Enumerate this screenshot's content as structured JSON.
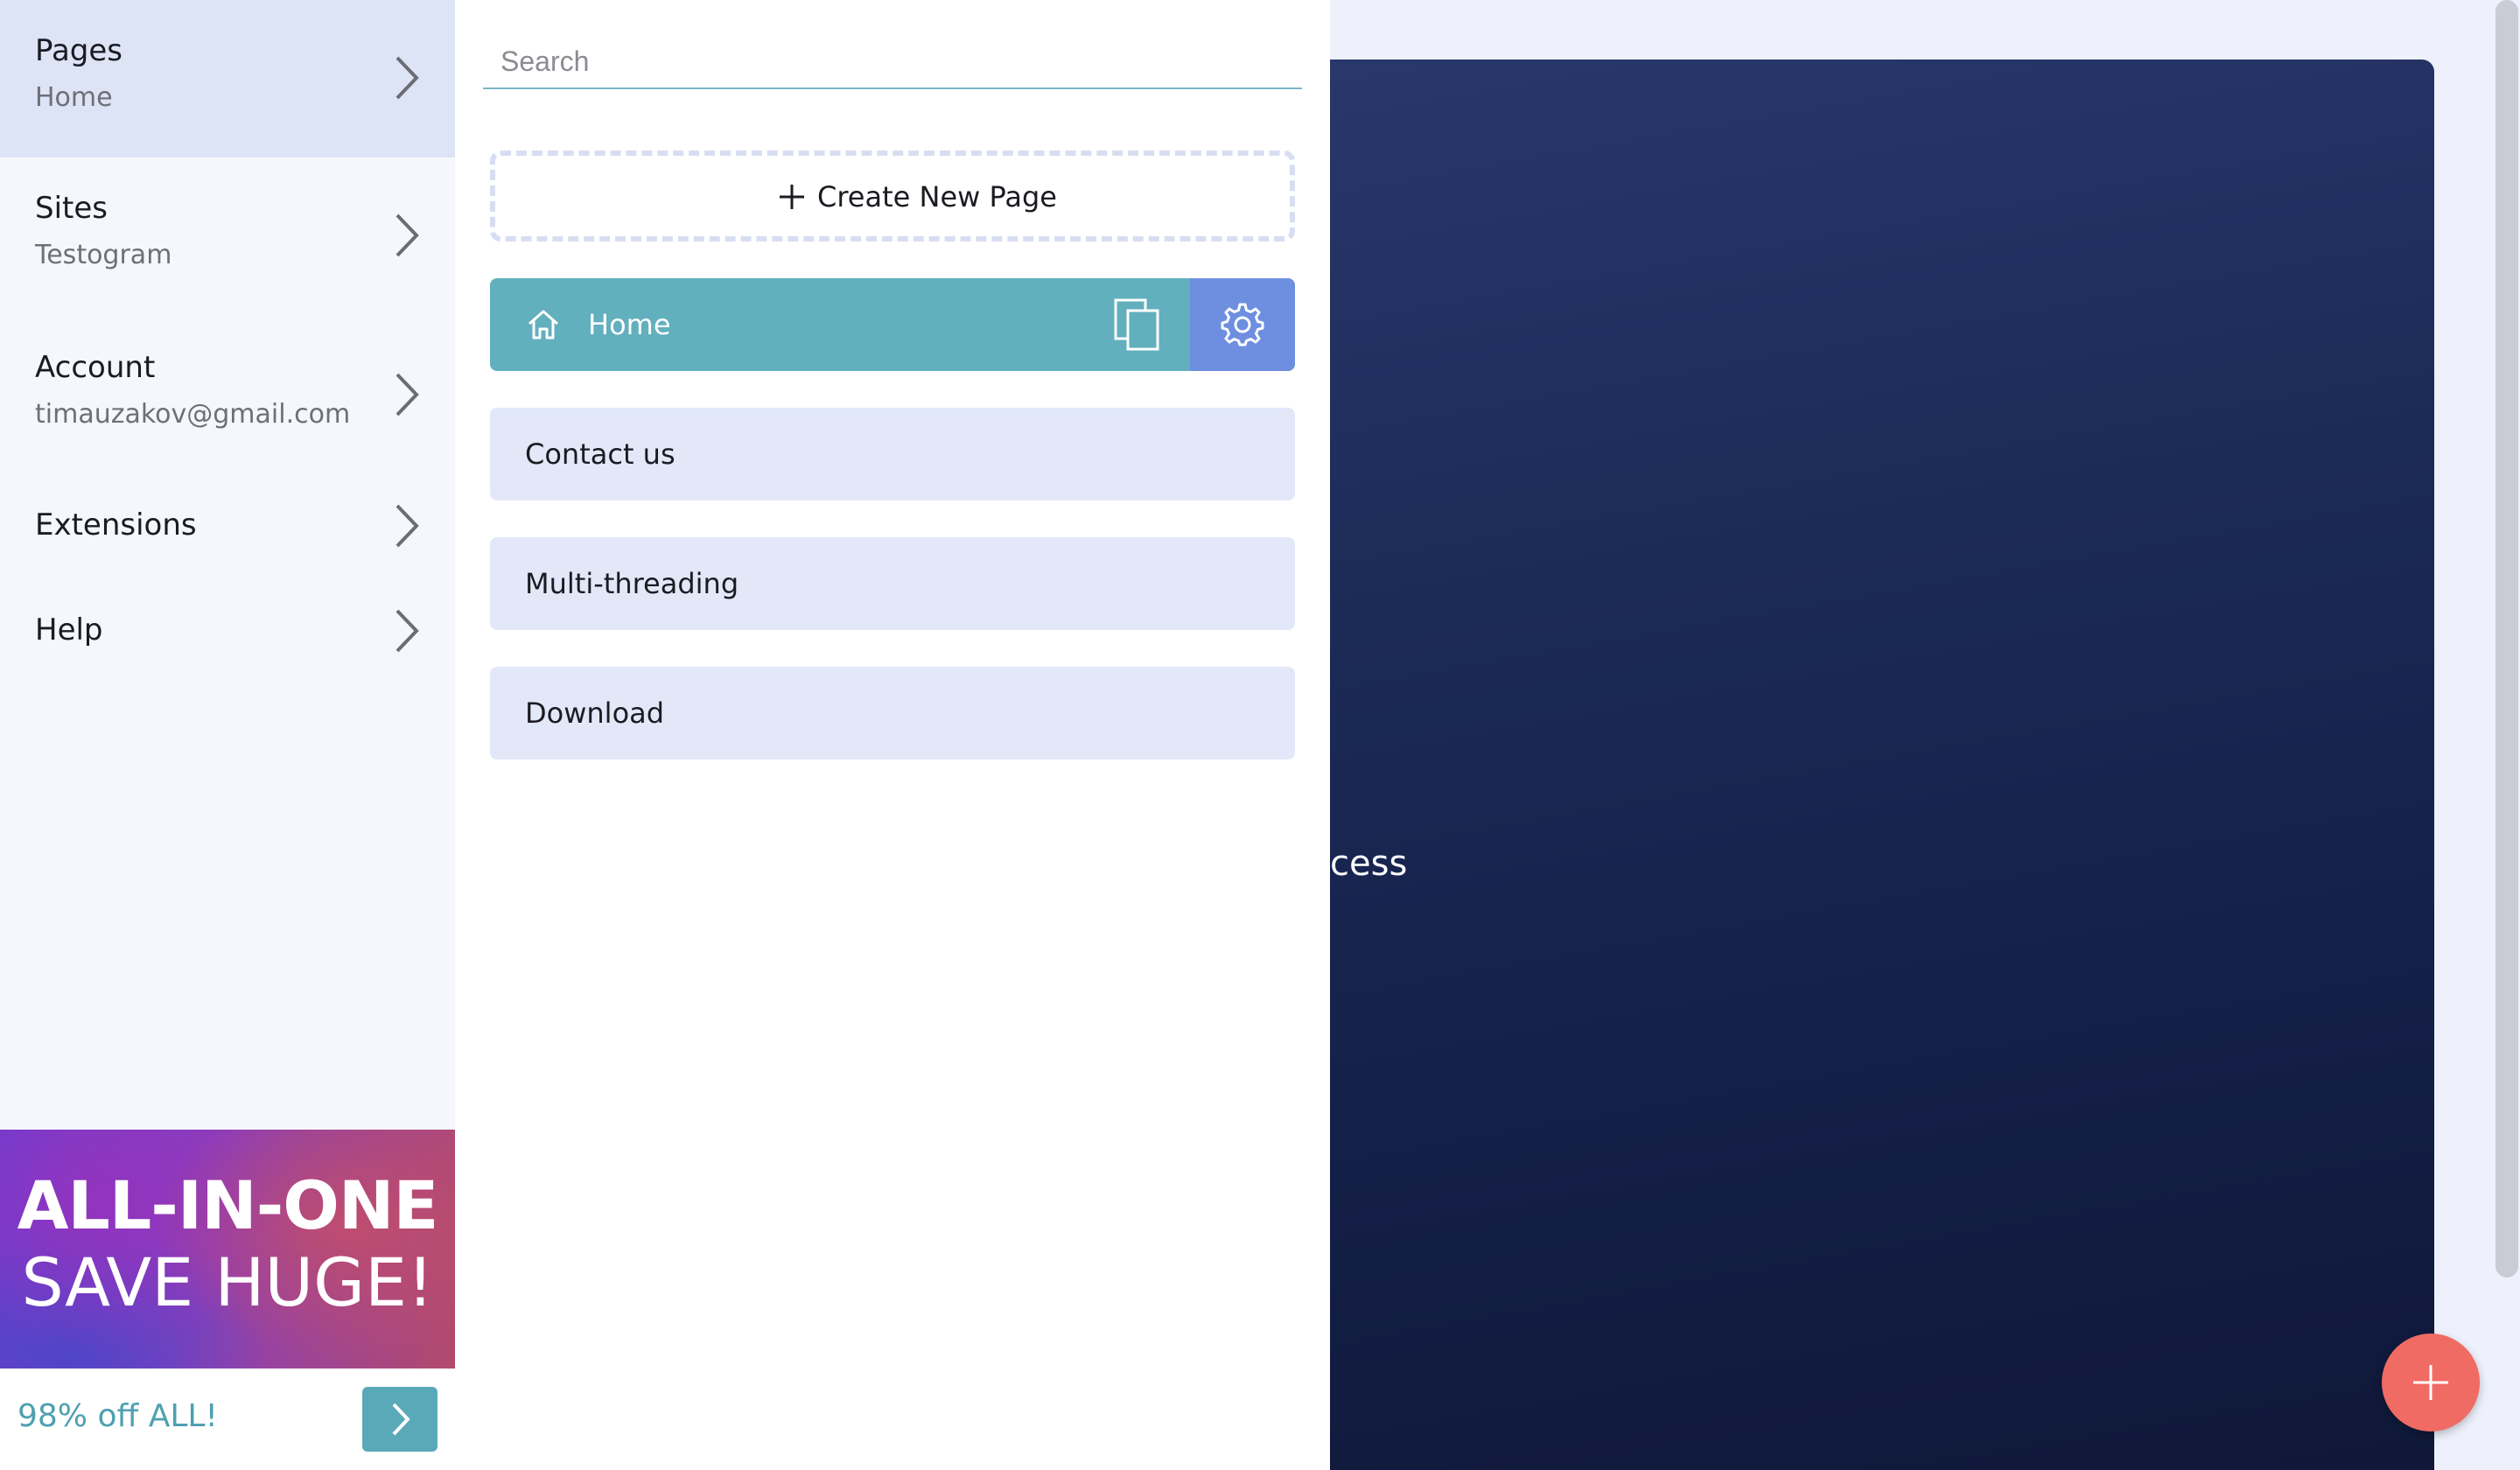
{
  "nav": {
    "items": [
      {
        "title": "Pages",
        "subtitle": "Home"
      },
      {
        "title": "Sites",
        "subtitle": "Testogram"
      },
      {
        "title": "Account",
        "subtitle": "timauzakov@gmail.com"
      },
      {
        "title": "Extensions",
        "subtitle": ""
      },
      {
        "title": "Help",
        "subtitle": ""
      }
    ],
    "active_index": 0
  },
  "promo": {
    "line1": "ALL-IN-ONE",
    "line2": "SAVE HUGE!",
    "offer": "98% off ALL!"
  },
  "pages_panel": {
    "search_placeholder": "Search",
    "create_label": "Create New Page",
    "pages": [
      {
        "label": "Home",
        "is_home": true,
        "selected": true
      },
      {
        "label": "Contact us"
      },
      {
        "label": "Multi-threading"
      },
      {
        "label": "Download"
      }
    ]
  },
  "preview": {
    "partial_text": "cess"
  },
  "colors": {
    "accent_teal": "#62afbe",
    "accent_blue": "#6e8fe0",
    "fab_red": "#ef6b63",
    "canvas_dark": "#1c2a57"
  },
  "icons": [
    "chevron-right-icon",
    "plus-icon",
    "home-icon",
    "duplicate-icon",
    "gear-icon"
  ]
}
